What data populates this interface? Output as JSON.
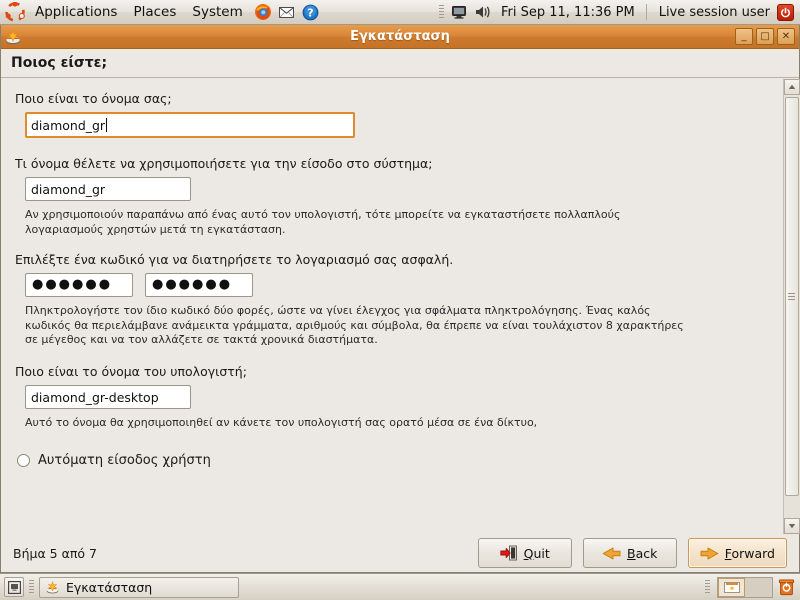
{
  "top_panel": {
    "logo_icon": "ubuntu-logo-icon",
    "menus": [
      {
        "label": "Applications",
        "name": "menu-applications"
      },
      {
        "label": "Places",
        "name": "menu-places"
      },
      {
        "label": "System",
        "name": "menu-system"
      }
    ],
    "launchers": [
      {
        "name": "firefox-icon",
        "title": "Firefox"
      },
      {
        "name": "mail-icon",
        "title": "Evolution Mail"
      },
      {
        "name": "help-icon",
        "title": "Help"
      }
    ],
    "tray": {
      "display_icon": "monitor-icon",
      "volume_icon": "volume-icon",
      "clock": "Fri Sep 11, 11:36 PM",
      "user": "Live session user",
      "power_icon": "power-icon"
    }
  },
  "window": {
    "icon": "installer-icon",
    "title": "Εγκατάσταση",
    "buttons": {
      "minimize": "_",
      "maximize": "□",
      "close": "✕"
    }
  },
  "page": {
    "title": "Ποιος είστε;"
  },
  "form": {
    "full_name": {
      "label": "Ποιο είναι το όνομα σας;",
      "value": "diamond_gr",
      "placeholder": "",
      "focused": true
    },
    "username": {
      "label": "Τι όνομα θέλετε να χρησιμοποιήσετε για την είσοδο στο σύστημα;",
      "value": "diamond_gr",
      "placeholder": "",
      "hint": "Αν χρησιμοποιούν παραπάνω από ένας αυτό τον υπολογιστή, τότε μπορείτε να εγκαταστήσετε πολλαπλούς λογαριασμούς χρηστών μετά τη εγκατάσταση."
    },
    "password": {
      "label": "Επιλέξτε ένα κωδικό για να διατηρήσετε το λογαριασμό σας ασφαλή.",
      "value": "●●●●●●",
      "confirm_value": "●●●●●●",
      "hint": "Πληκτρολογήστε τον ίδιο κωδικό δύο φορές, ώστε να γίνει έλεγχος για σφάλματα πληκτρολόγησης. Ένας καλός κωδικός θα περιελάμβανε ανάμεικτα γράμματα, αριθμούς και σύμβολα, θα έπρεπε να είναι τουλάχιστον 8 χαρακτήρες σε μέγεθος και να τον αλλάζετε σε τακτά χρονικά διαστήματα."
    },
    "hostname": {
      "label": "Ποιο είναι το όνομα του υπολογιστή;",
      "value": "diamond_gr-desktop",
      "placeholder": "",
      "hint": "Αυτό το όνομα θα χρησιμοποιηθεί αν κάνετε τον υπολογιστή σας ορατό μέσα σε ένα δίκτυο,"
    },
    "autologin": {
      "label": "Αυτόματη είσοδος χρήστη",
      "checked": false
    }
  },
  "footer": {
    "step_text": "Βήμα 5 από 7",
    "buttons": {
      "quit": "Quit",
      "back": "Back",
      "forward": "Forward"
    },
    "forward_focused": true
  },
  "bottom_panel": {
    "show_desktop_icon": "show-desktop-icon",
    "task": {
      "icon": "installer-icon",
      "label": "Εγκατάσταση"
    },
    "workspaces": [
      {
        "active": true
      },
      {
        "active": false
      }
    ],
    "trash_icon": "trash-icon"
  },
  "colors": {
    "titlebar_accent": "#d9873a",
    "focus_border": "#e08a2c",
    "window_bg": "#ece9e4",
    "power_red": "#c41f08"
  }
}
